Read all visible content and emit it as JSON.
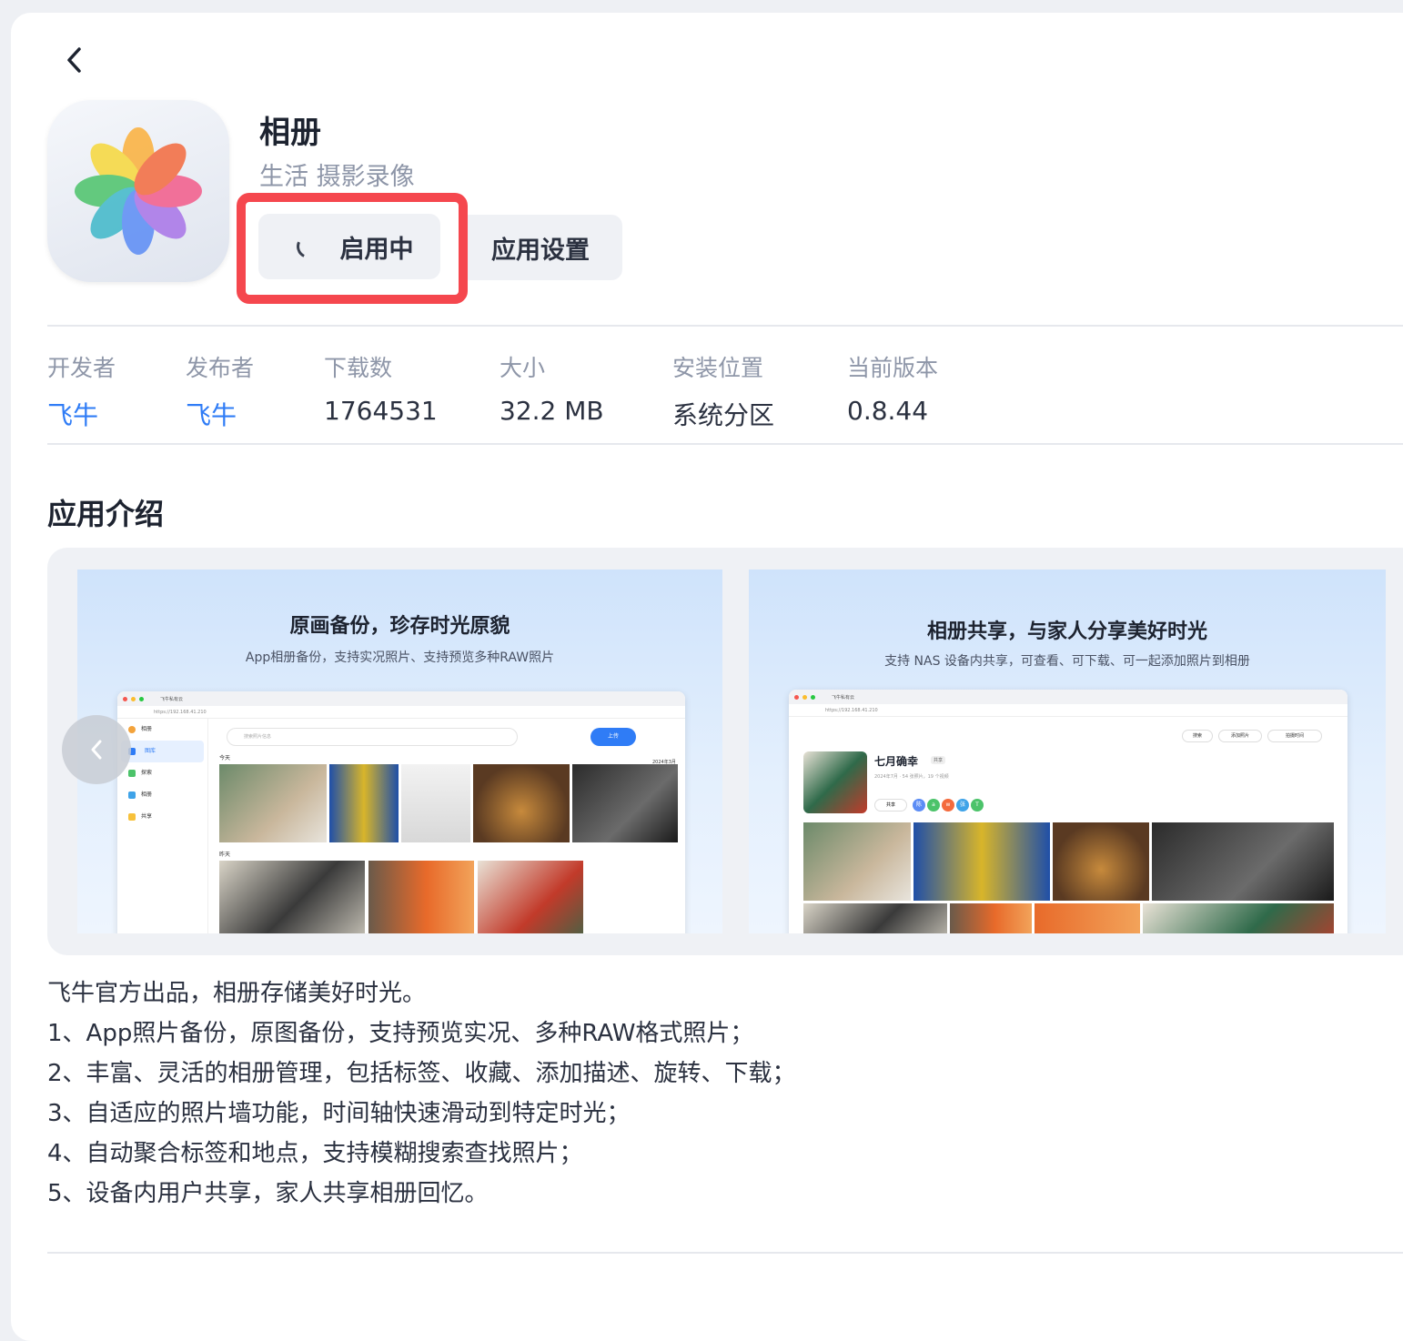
{
  "app": {
    "title": "相册",
    "category": "生活 摄影录像",
    "enable_label": "启用中",
    "settings_label": "应用设置"
  },
  "meta": [
    {
      "label": "开发者",
      "value": "飞牛",
      "link": true
    },
    {
      "label": "发布者",
      "value": "飞牛",
      "link": true
    },
    {
      "label": "下载数",
      "value": "1764531",
      "link": false
    },
    {
      "label": "大小",
      "value": "32.2 MB",
      "link": false
    },
    {
      "label": "安装位置",
      "value": "系统分区",
      "link": false
    },
    {
      "label": "当前版本",
      "value": "0.8.44",
      "link": false
    }
  ],
  "intro": {
    "title": "应用介绍",
    "screenshots": [
      {
        "headline": "原画备份，珍存时光原貌",
        "subline": "App相册备份，支持实况照片、支持预览多种RAW照片",
        "window": {
          "tab": "飞牛私有云",
          "url": "https://192.168.41.210",
          "app_name": "相册",
          "search_placeholder": "搜索照片信息",
          "upload": "上传",
          "nav": [
            "图库",
            "探索",
            "相册",
            "共享"
          ],
          "today": "今天",
          "yesterday": "昨天",
          "date_tag": "2024年3月"
        }
      },
      {
        "headline": "相册共享，与家人分享美好时光",
        "subline": "支持 NAS 设备内共享，可查看、可下载、可一起添加照片到相册",
        "window": {
          "tab": "飞牛私有云",
          "url": "https://192.168.41.210",
          "album_name": "七月确幸",
          "album_tag": "共享",
          "album_info": "2024年7月 · 54 张照片，19 个视频",
          "share_btn": "共享",
          "search": "搜索",
          "add_photo": "添加照片",
          "sort": "拍摄时间",
          "members": [
            "陈",
            "a",
            "w",
            "张",
            "T"
          ]
        }
      }
    ]
  },
  "description": [
    "飞牛官方出品，相册存储美好时光。",
    "1、App照片备份，原图备份，支持预览实况、多种RAW格式照片；",
    "2、丰富、灵活的相册管理，包括标签、收藏、添加描述、旋转、下载；",
    "3、自适应的照片墙功能，时间轴快速滑动到特定时光；",
    "4、自动聚合标签和地点，支持模糊搜索查找照片；",
    "5、设备内用户共享，家人共享相册回忆。"
  ],
  "colors": {
    "accent": "#2f7cf6",
    "highlight": "#f5474e",
    "muted": "#8e96a8"
  }
}
